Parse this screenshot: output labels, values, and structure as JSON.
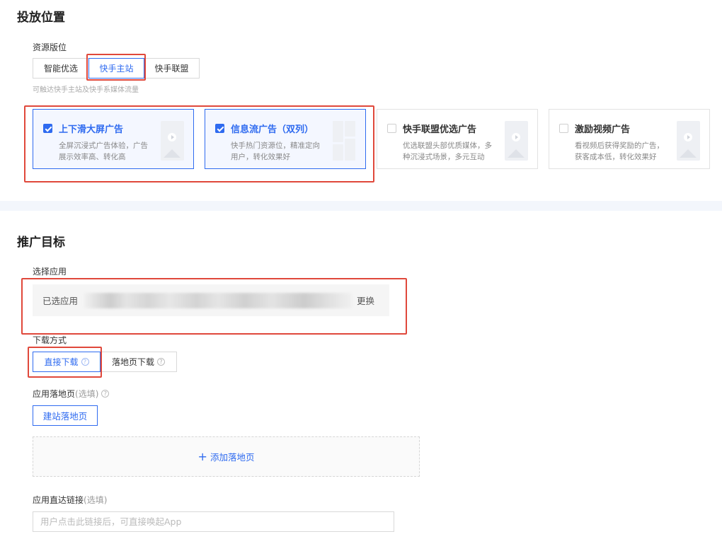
{
  "placement": {
    "title": "投放位置",
    "resource_label": "资源版位",
    "tabs": [
      {
        "label": "智能优选"
      },
      {
        "label": "快手主站"
      },
      {
        "label": "快手联盟"
      }
    ],
    "selected_tab": "快手主站",
    "hint": "可触达快手主站及快手系媒体流量",
    "cards": [
      {
        "title": "上下滑大屏广告",
        "desc": "全屏沉浸式广告体验，广告展示效率高、转化高",
        "checked": true
      },
      {
        "title": "信息流广告（双列）",
        "desc": "快手热门资源位，精准定向用户，转化效果好",
        "checked": true
      },
      {
        "title": "快手联盟优选广告",
        "desc": "优选联盟头部优质媒体，多种沉浸式场景，多元互动",
        "checked": false
      },
      {
        "title": "激励视频广告",
        "desc": "看视频后获得奖励的广告，获客成本低，转化效果好",
        "checked": false
      }
    ]
  },
  "promotion": {
    "title": "推广目标",
    "select_app_label": "选择应用",
    "selected_app_prefix": "已选应用",
    "change_label": "更换",
    "download_label": "下载方式",
    "download_options": [
      {
        "label": "直接下载"
      },
      {
        "label": "落地页下载"
      }
    ],
    "selected_download": "直接下载",
    "landing_label": "应用落地页",
    "optional": "(选填)",
    "build_landing_button": "建站落地页",
    "add_landing": "添加落地页",
    "deeplink_label": "应用直达链接",
    "deeplink_placeholder": "用户点击此链接后，可直接唤起App"
  },
  "colors": {
    "accent": "#2f6bf0",
    "highlight": "#e0483b"
  }
}
